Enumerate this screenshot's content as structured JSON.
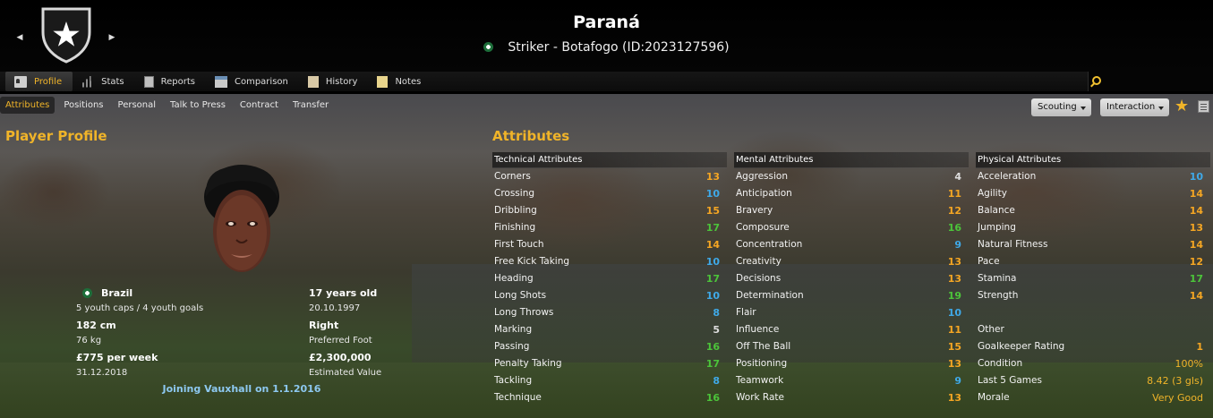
{
  "header": {
    "name": "Paraná",
    "subtitle": "Striker - Botafogo (ID:2023127596)"
  },
  "main_tabs": [
    {
      "label": "Profile",
      "icon": "profile-icon",
      "active": true
    },
    {
      "label": "Stats",
      "icon": "stats-icon"
    },
    {
      "label": "Reports",
      "icon": "reports-icon"
    },
    {
      "label": "Comparison",
      "icon": "comparison-icon"
    },
    {
      "label": "History",
      "icon": "history-icon"
    },
    {
      "label": "Notes",
      "icon": "notes-icon"
    }
  ],
  "sub_tabs": [
    {
      "label": "Attributes",
      "active": true
    },
    {
      "label": "Positions"
    },
    {
      "label": "Personal"
    },
    {
      "label": "Talk to Press"
    },
    {
      "label": "Contract"
    },
    {
      "label": "Transfer"
    }
  ],
  "toolbar": {
    "scouting_label": "Scouting",
    "interaction_label": "Interaction"
  },
  "profile": {
    "title": "Player Profile",
    "nationality": "Brazil",
    "caps": "5 youth caps / 4 youth goals",
    "height": "182 cm",
    "weight": "76 kg",
    "wage": "£775 per week",
    "wage_expiry": "31.12.2018",
    "age": "17 years old",
    "dob": "20.10.1997",
    "foot": "Right",
    "foot_label": "Preferred Foot",
    "value": "£2,300,000",
    "value_label": "Estimated Value",
    "joining": "Joining Vauxhall on 1.1.2016"
  },
  "attributes": {
    "title": "Attributes",
    "technical": {
      "header": "Technical Attributes",
      "rows": [
        {
          "name": "Corners",
          "value": "13"
        },
        {
          "name": "Crossing",
          "value": "10"
        },
        {
          "name": "Dribbling",
          "value": "15"
        },
        {
          "name": "Finishing",
          "value": "17"
        },
        {
          "name": "First Touch",
          "value": "14"
        },
        {
          "name": "Free Kick Taking",
          "value": "10"
        },
        {
          "name": "Heading",
          "value": "17"
        },
        {
          "name": "Long Shots",
          "value": "10"
        },
        {
          "name": "Long Throws",
          "value": "8"
        },
        {
          "name": "Marking",
          "value": "5"
        },
        {
          "name": "Passing",
          "value": "16"
        },
        {
          "name": "Penalty Taking",
          "value": "17"
        },
        {
          "name": "Tackling",
          "value": "8"
        },
        {
          "name": "Technique",
          "value": "16"
        }
      ]
    },
    "mental": {
      "header": "Mental Attributes",
      "rows": [
        {
          "name": "Aggression",
          "value": "4"
        },
        {
          "name": "Anticipation",
          "value": "11"
        },
        {
          "name": "Bravery",
          "value": "12"
        },
        {
          "name": "Composure",
          "value": "16"
        },
        {
          "name": "Concentration",
          "value": "9"
        },
        {
          "name": "Creativity",
          "value": "13"
        },
        {
          "name": "Decisions",
          "value": "13"
        },
        {
          "name": "Determination",
          "value": "19"
        },
        {
          "name": "Flair",
          "value": "10"
        },
        {
          "name": "Influence",
          "value": "11"
        },
        {
          "name": "Off The Ball",
          "value": "15"
        },
        {
          "name": "Positioning",
          "value": "13"
        },
        {
          "name": "Teamwork",
          "value": "9"
        },
        {
          "name": "Work Rate",
          "value": "13"
        }
      ]
    },
    "physical": {
      "header": "Physical Attributes",
      "rows": [
        {
          "name": "Acceleration",
          "value": "10"
        },
        {
          "name": "Agility",
          "value": "14"
        },
        {
          "name": "Balance",
          "value": "14"
        },
        {
          "name": "Jumping",
          "value": "13"
        },
        {
          "name": "Natural Fitness",
          "value": "14"
        },
        {
          "name": "Pace",
          "value": "12"
        },
        {
          "name": "Stamina",
          "value": "17"
        },
        {
          "name": "Strength",
          "value": "14"
        }
      ]
    },
    "other": {
      "header": "Other",
      "rows": [
        {
          "name": "Goalkeeper Rating",
          "value": "1"
        },
        {
          "name": "Condition",
          "value": "100%"
        },
        {
          "name": "Last 5 Games",
          "value": "8.42 (3 gls)"
        },
        {
          "name": "Morale",
          "value": "Very Good"
        }
      ]
    }
  },
  "colors": {
    "accent": "#f0b429",
    "low": "#dedede",
    "mid": "#3fa9e8",
    "good": "#f5a623",
    "high": "#4cc43a",
    "link": "#8dc8f0"
  }
}
